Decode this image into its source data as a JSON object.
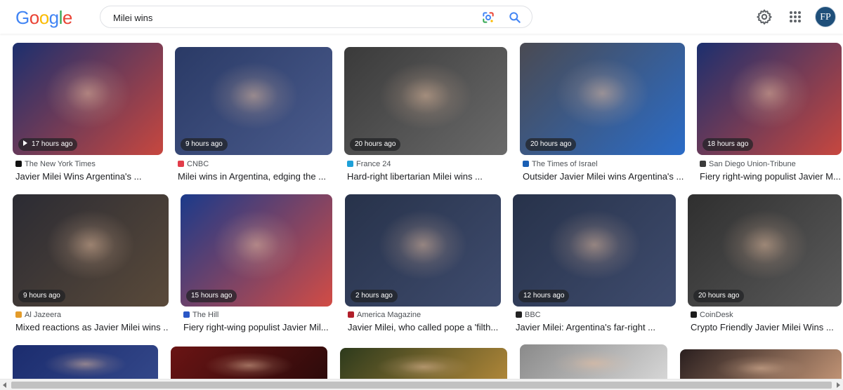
{
  "logo": {
    "letters": [
      "G",
      "o",
      "o",
      "g",
      "l",
      "e"
    ],
    "colors": [
      "#4285F4",
      "#EA4335",
      "#FBBC05",
      "#4285F4",
      "#34A853",
      "#EA4335"
    ]
  },
  "search": {
    "query": "Milei wins"
  },
  "header": {
    "avatar_initials": "FP"
  },
  "colors": {
    "google_blue": "#1a73e8",
    "text_primary": "#202124",
    "text_secondary": "#4d5156"
  },
  "results": [
    {
      "time": "17 hours ago",
      "video": true,
      "source": "The New York Times",
      "fav_color": "#111111",
      "title": "Javier Milei Wins Argentina's ...",
      "img_colors": [
        "#1c2f6e",
        "#c7473f"
      ]
    },
    {
      "time": "9 hours ago",
      "video": false,
      "source": "CNBC",
      "fav_color": "#e23d4a",
      "title": "Milei wins in Argentina, edging the ...",
      "img_colors": [
        "#2a3a66",
        "#4a5b8c"
      ]
    },
    {
      "time": "20 hours ago",
      "video": false,
      "source": "France 24",
      "fav_color": "#1ea0d8",
      "title": "Hard-right libertarian Milei wins ...",
      "img_colors": [
        "#3a3a3a",
        "#6a6a6a"
      ]
    },
    {
      "time": "20 hours ago",
      "video": false,
      "source": "The Times of Israel",
      "fav_color": "#1a5fb4",
      "title": "Outsider Javier Milei wins Argentina's ...",
      "img_colors": [
        "#4a4a52",
        "#2b6cc7"
      ]
    },
    {
      "time": "18 hours ago",
      "video": false,
      "source": "San Diego Union-Tribune",
      "fav_color": "#3b3b3b",
      "title": "Fiery right-wing populist Javier M...",
      "img_colors": [
        "#1c2f6e",
        "#c7473f"
      ]
    },
    {
      "time": "9 hours ago",
      "video": false,
      "source": "Al Jazeera",
      "fav_color": "#e39b2a",
      "title": "Mixed reactions as Javier Milei wins ...",
      "img_colors": [
        "#2b2b33",
        "#5a4a3a"
      ]
    },
    {
      "time": "15 hours ago",
      "video": false,
      "source": "The Hill",
      "fav_color": "#2a57c6",
      "title": "Fiery right-wing populist Javier Mil...",
      "img_colors": [
        "#1b3a8a",
        "#d24c45"
      ]
    },
    {
      "time": "2 hours ago",
      "video": false,
      "source": "America Magazine",
      "fav_color": "#b11f2a",
      "title": "Javier Milei, who called pope a 'filth...",
      "img_colors": [
        "#27324a",
        "#3f4c6e"
      ]
    },
    {
      "time": "12 hours ago",
      "video": false,
      "source": "BBC",
      "fav_color": "#222222",
      "title": "Javier Milei: Argentina's far-right ...",
      "img_colors": [
        "#27324a",
        "#3f4c6e"
      ]
    },
    {
      "time": "20 hours ago",
      "video": false,
      "source": "CoinDesk",
      "fav_color": "#1d1d1d",
      "title": "Crypto Friendly Javier Milei Wins ...",
      "img_colors": [
        "#2f2f2f",
        "#5b5b5b"
      ]
    },
    {
      "time": "",
      "video": false,
      "source": "",
      "fav_color": "#000000",
      "title": "",
      "img_colors": [
        "#1b2c6e",
        "#34488a"
      ]
    },
    {
      "time": "",
      "video": false,
      "source": "",
      "fav_color": "#000000",
      "title": "",
      "img_colors": [
        "#6a1414",
        "#2a0a0a"
      ]
    },
    {
      "time": "",
      "video": false,
      "source": "",
      "fav_color": "#000000",
      "title": "",
      "img_colors": [
        "#2d3a1c",
        "#b58a3a"
      ]
    },
    {
      "time": "",
      "video": false,
      "source": "",
      "fav_color": "#000000",
      "title": "",
      "img_colors": [
        "#8a8a8a",
        "#d9d9d9"
      ]
    },
    {
      "time": "",
      "video": false,
      "source": "",
      "fav_color": "#000000",
      "title": "",
      "img_colors": [
        "#2a1f1f",
        "#c99a7a"
      ]
    }
  ]
}
